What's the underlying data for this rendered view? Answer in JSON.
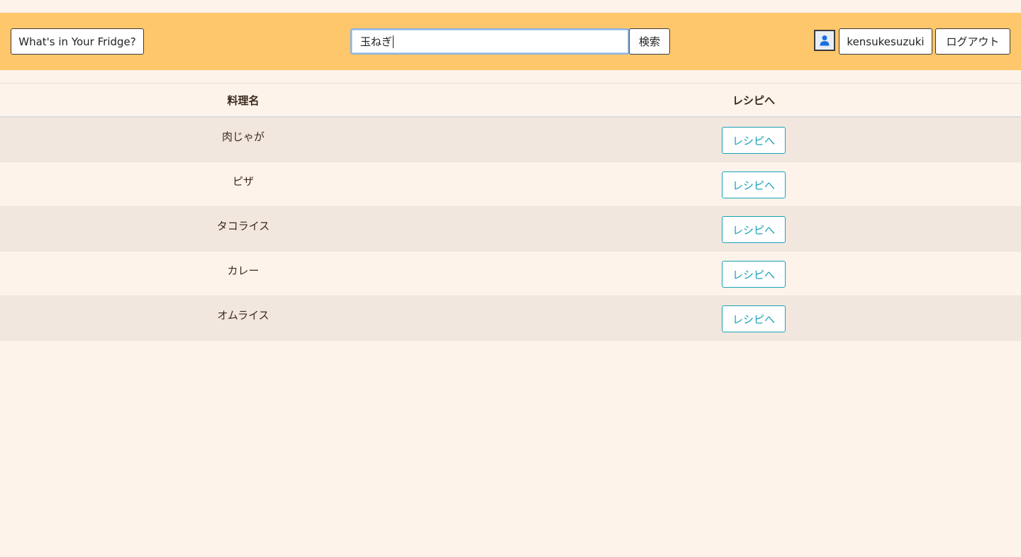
{
  "navbar": {
    "brand_label": "What's in Your Fridge?",
    "search_value": "玉ねぎ",
    "search_button_label": "検索",
    "user_icon": "person-icon",
    "username": "kensukesuzuki",
    "logout_label": "ログアウト",
    "bg_color": "#ffc76b"
  },
  "table": {
    "headers": [
      "料理名",
      "レシピへ"
    ],
    "rows": [
      {
        "name": "肉じゃが",
        "link_label": "レシピへ"
      },
      {
        "name": "ピザ",
        "link_label": "レシピへ"
      },
      {
        "name": "タコライス",
        "link_label": "レシピへ"
      },
      {
        "name": "カレー",
        "link_label": "レシピへ"
      },
      {
        "name": "オムライス",
        "link_label": "レシピへ"
      }
    ],
    "accent_color": "#17a2b8"
  }
}
